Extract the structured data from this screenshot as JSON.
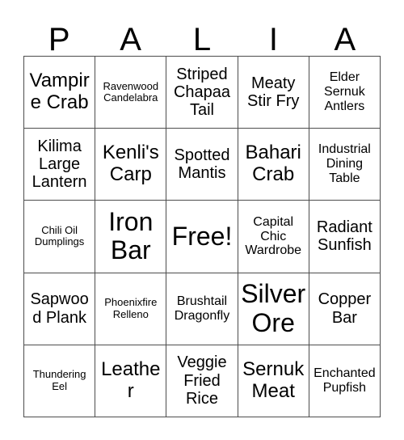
{
  "card": {
    "title_letters": [
      "P",
      "A",
      "L",
      "I",
      "A"
    ],
    "grid_size": 5,
    "free_space": {
      "row": 3,
      "column": 3,
      "label": "Free!"
    },
    "colors": {
      "background": "#ffffff",
      "text": "#000000",
      "gridline": "#4d4d4d"
    },
    "rows": [
      {
        "cells": [
          {
            "label": "Vampire Crab",
            "size": "lg",
            "marked": false
          },
          {
            "label": "Ravenwood Candelabra",
            "size": "xs",
            "marked": false
          },
          {
            "label": "Striped Chapaa Tail",
            "size": "md",
            "marked": false
          },
          {
            "label": "Meaty Stir Fry",
            "size": "md",
            "marked": false
          },
          {
            "label": "Elder Sernuk Antlers",
            "size": "sm",
            "marked": false
          }
        ]
      },
      {
        "cells": [
          {
            "label": "Kilima Large Lantern",
            "size": "md",
            "marked": false
          },
          {
            "label": "Kenli's Carp",
            "size": "lg",
            "marked": false
          },
          {
            "label": "Spotted Mantis",
            "size": "md",
            "marked": false
          },
          {
            "label": "Bahari Crab",
            "size": "lg",
            "marked": false
          },
          {
            "label": "Industrial Dining Table",
            "size": "sm",
            "marked": false
          }
        ]
      },
      {
        "cells": [
          {
            "label": "Chili Oil Dumplings",
            "size": "xs",
            "marked": false
          },
          {
            "label": "Iron Bar",
            "size": "xl",
            "marked": false
          },
          {
            "label": "Free!",
            "size": "xl",
            "marked": false
          },
          {
            "label": "Capital Chic Wardrobe",
            "size": "sm",
            "marked": false
          },
          {
            "label": "Radiant Sunfish",
            "size": "md",
            "marked": false
          }
        ]
      },
      {
        "cells": [
          {
            "label": "Sapwood Plank",
            "size": "md",
            "marked": false
          },
          {
            "label": "Phoenixfire Relleno",
            "size": "xs",
            "marked": false
          },
          {
            "label": "Brushtail Dragonfly",
            "size": "sm",
            "marked": false
          },
          {
            "label": "Silver Ore",
            "size": "xl",
            "marked": false
          },
          {
            "label": "Copper Bar",
            "size": "md",
            "marked": false
          }
        ]
      },
      {
        "cells": [
          {
            "label": "Thundering Eel",
            "size": "xs",
            "marked": false
          },
          {
            "label": "Leather",
            "size": "lg",
            "marked": false
          },
          {
            "label": "Veggie Fried Rice",
            "size": "md",
            "marked": false
          },
          {
            "label": "Sernuk Meat",
            "size": "lg",
            "marked": false
          },
          {
            "label": "Enchanted Pupfish",
            "size": "sm",
            "marked": false
          }
        ]
      }
    ]
  }
}
